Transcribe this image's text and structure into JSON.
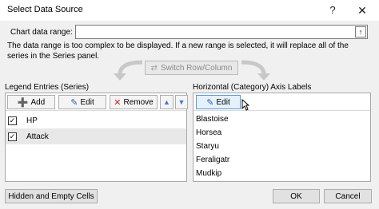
{
  "window": {
    "title": "Select Data Source",
    "help": "?",
    "close": "✕"
  },
  "range": {
    "label": "Chart data range:",
    "value": "",
    "picker": "↑"
  },
  "message": "The data range is too complex to be displayed. If a new range is selected, it will replace all of the series in the Series panel.",
  "switch_label": "Switch Row/Column",
  "legend": {
    "title": "Legend Entries (Series)",
    "add": "Add",
    "edit": "Edit",
    "remove": "Remove",
    "up": "▲",
    "down": "▼",
    "series": [
      {
        "name": "HP",
        "checked": "✓"
      },
      {
        "name": "Attack",
        "checked": "✓"
      }
    ]
  },
  "axis": {
    "title": "Horizontal (Category) Axis Labels",
    "edit": "Edit",
    "categories": [
      "Blastoise",
      "Horsea",
      "Staryu",
      "Feraligatr",
      "Mudkip"
    ]
  },
  "footer": {
    "hidden_cells": "Hidden and Empty Cells",
    "ok": "OK",
    "cancel": "Cancel"
  }
}
